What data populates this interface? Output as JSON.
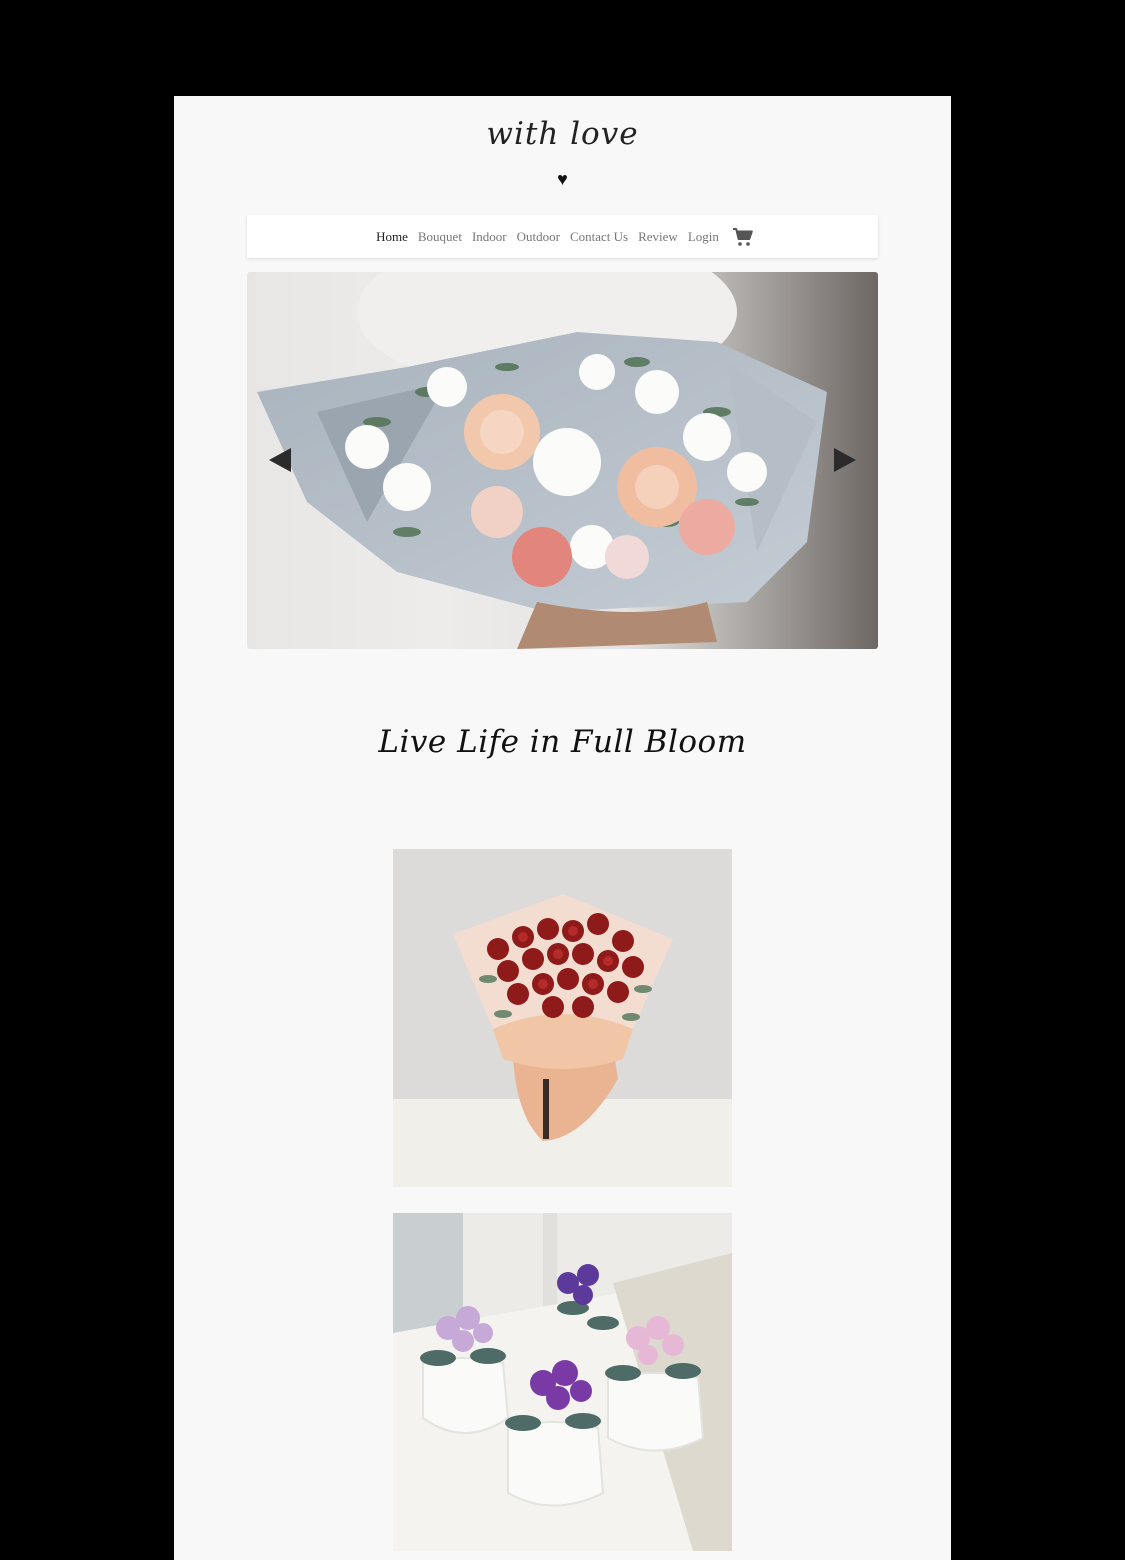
{
  "brand": {
    "title": "with love",
    "heart": "♥"
  },
  "nav": {
    "items": [
      {
        "label": "Home",
        "active": true
      },
      {
        "label": "Bouquet"
      },
      {
        "label": "Indoor"
      },
      {
        "label": "Outdoor"
      },
      {
        "label": "Contact Us"
      },
      {
        "label": "Review"
      },
      {
        "label": "Login"
      }
    ],
    "cart_icon": "shopping-cart-icon"
  },
  "hero": {
    "image": "bouquet-of-peach-roses-and-white-flowers-in-gray-wrap",
    "prev_icon": "triangle-left-icon",
    "next_icon": "triangle-right-icon"
  },
  "tagline": "Live Life in Full Bloom",
  "products": [
    {
      "image": "red-roses-bouquet-peach-wrap"
    },
    {
      "image": "potted-african-violets-white-pots"
    }
  ],
  "colors": {
    "page_bg": "#f8f8f8",
    "nav_active": "#222222",
    "nav_inactive": "#777777"
  }
}
